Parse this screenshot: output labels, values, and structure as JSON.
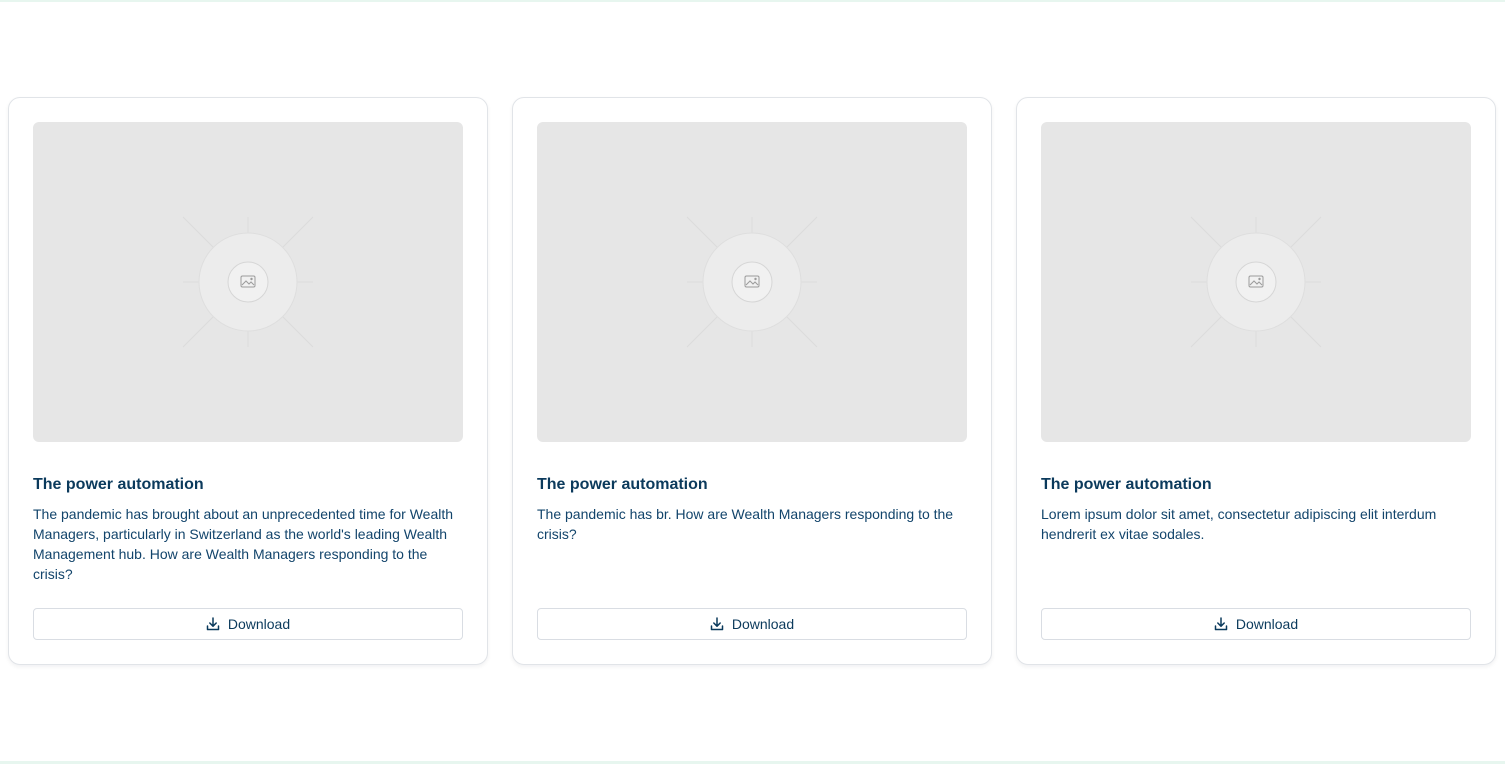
{
  "cards": [
    {
      "title": "The power automation",
      "description": "The pandemic has brought about an unprecedented time for Wealth Managers, particularly in Switzerland as the world's leading Wealth Management hub. How are Wealth Managers responding to the crisis?",
      "button_label": "Download",
      "image_icon": "image-placeholder-icon",
      "button_icon": "download-icon"
    },
    {
      "title": "The power automation",
      "description": "The pandemic has br. How are Wealth Managers responding to the crisis?",
      "button_label": "Download",
      "image_icon": "image-placeholder-icon",
      "button_icon": "download-icon"
    },
    {
      "title": "The power automation",
      "description": "Lorem ipsum dolor sit amet, consectetur adipiscing elit interdum hendrerit ex vitae sodales.",
      "button_label": "Download",
      "image_icon": "image-placeholder-icon",
      "button_icon": "download-icon"
    }
  ],
  "colors": {
    "text_primary": "#0b3a5c",
    "placeholder_bg": "#e6e6e6",
    "card_border": "#e1e4e8",
    "accent_line": "#e7f6ef"
  }
}
